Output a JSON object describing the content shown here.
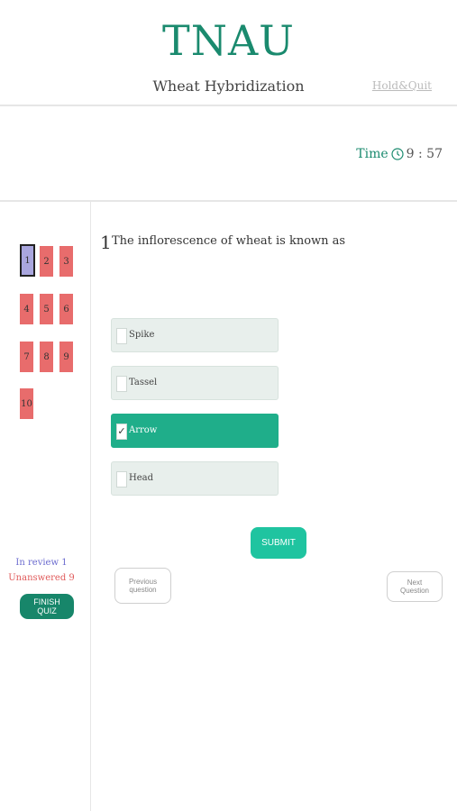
{
  "header": {
    "brand": "TNAU",
    "subtitle": "Wheat Hybridization",
    "hold_quit": "Hold&Quit"
  },
  "timer": {
    "label": "Time",
    "value": "9 : 57"
  },
  "sidebar": {
    "questions": [
      "1",
      "2",
      "3",
      "4",
      "5",
      "6",
      "7",
      "8",
      "9",
      "10"
    ],
    "in_review": "In review 1",
    "unanswered": "Unanswered 9",
    "finish_label": "FINISH QUIZ"
  },
  "question": {
    "number": "1",
    "text": "The inflorescence of wheat is known as",
    "options": [
      "Spike",
      "Tassel",
      "Arrow",
      "Head"
    ],
    "selected": "Arrow",
    "check_mark": "✓"
  },
  "actions": {
    "submit": "SUBMIT",
    "previous": "Previous question",
    "next": "Next Question"
  },
  "colors": {
    "accent": "#1a8a6e",
    "submit": "#1fc4a0",
    "selected_option": "#1fae8a",
    "unvisited": "#e86c6c",
    "current": "#a9a6de"
  }
}
